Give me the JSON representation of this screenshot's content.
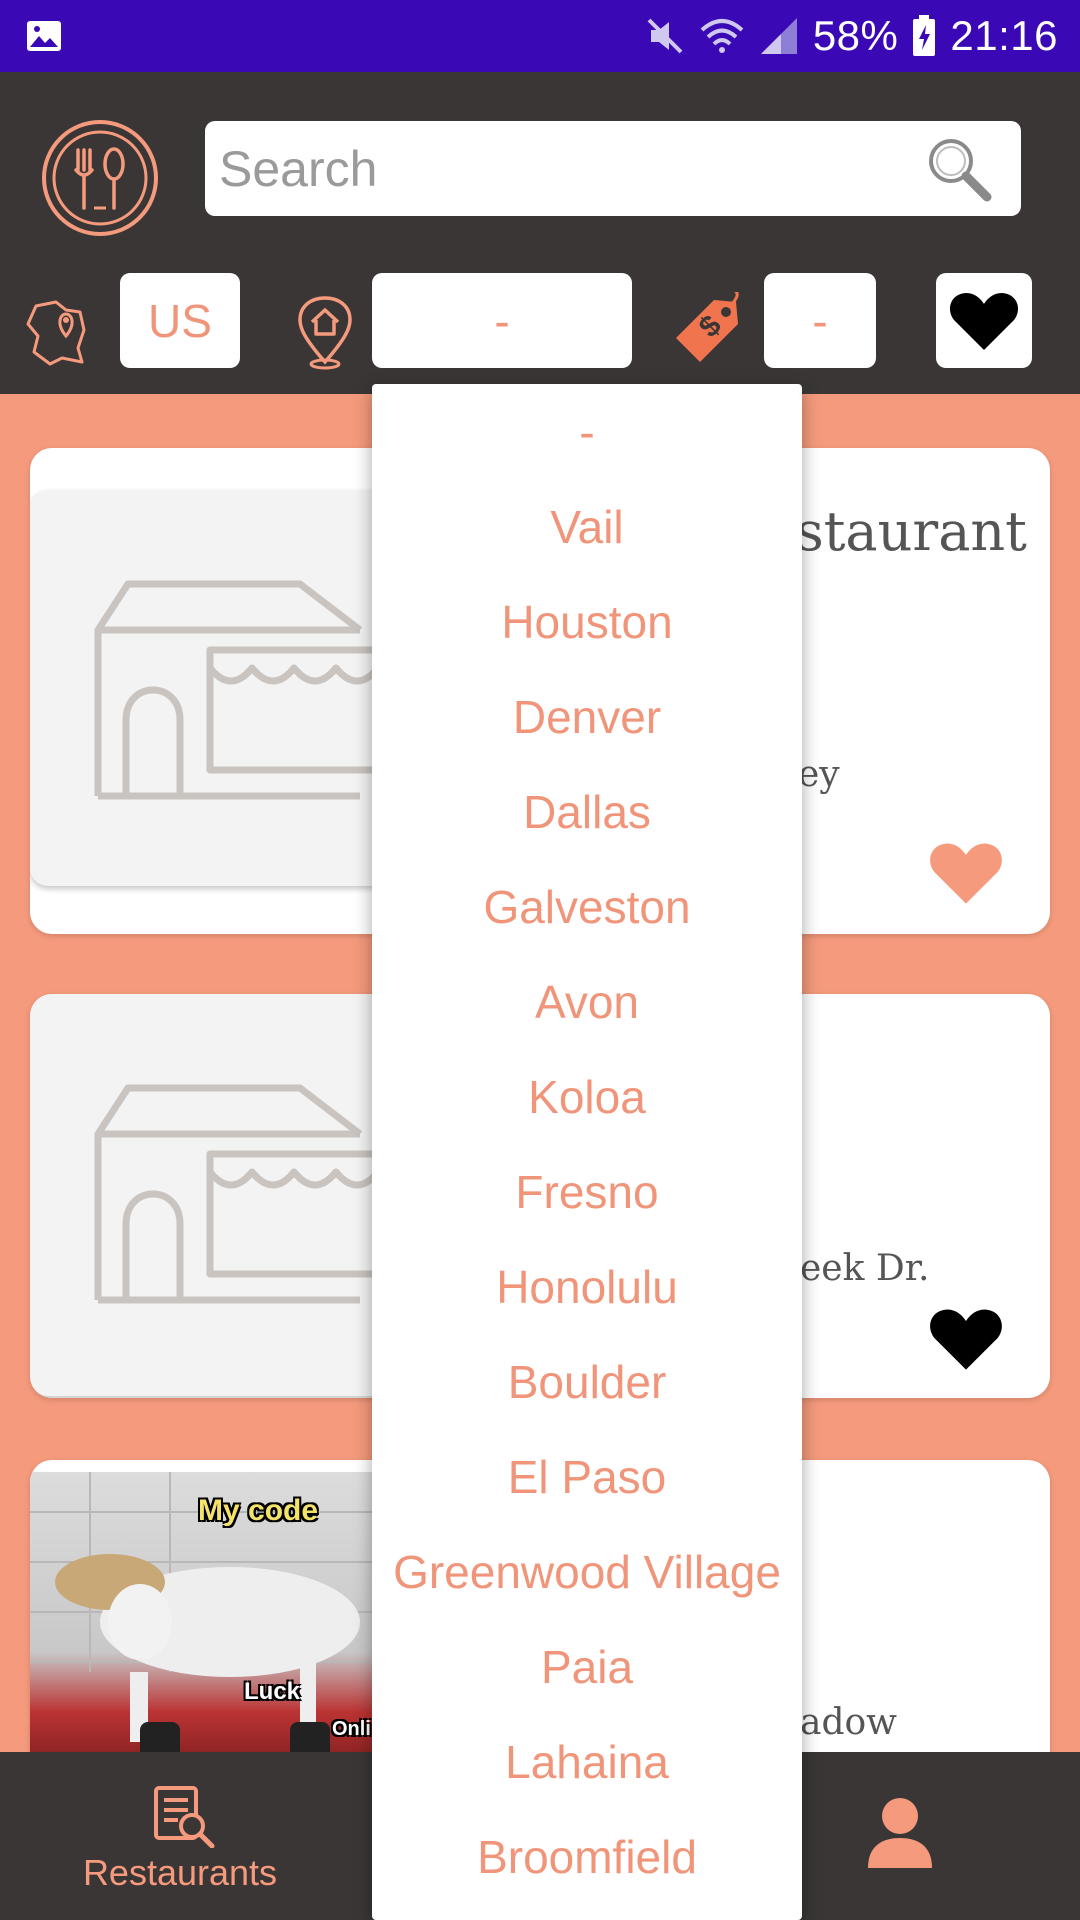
{
  "status_bar": {
    "battery": "58%",
    "time": "21:16"
  },
  "search": {
    "placeholder": "Search"
  },
  "filters": {
    "country": "US",
    "city": "-",
    "price": "-"
  },
  "cards": [
    {
      "title_fragment": "staurant",
      "subtitle_fragment": "ey",
      "favorite": true
    },
    {
      "subtitle_fragment": "eek Dr.",
      "favorite": false
    },
    {
      "subtitle_fragment": "adow",
      "meme_caption_top": "My code",
      "meme_caption_bottom": "Luck",
      "meme_caption_side": "Onli"
    }
  ],
  "dropdown": {
    "options": [
      "-",
      "Vail",
      "Houston",
      "Denver",
      "Dallas",
      "Galveston",
      "Avon",
      "Koloa",
      "Fresno",
      "Honolulu",
      "Boulder",
      "El Paso",
      "Greenwood Village",
      "Paia",
      "Lahaina",
      "Broomfield"
    ]
  },
  "bottom_nav": {
    "restaurants_label": "Restaurants"
  },
  "colors": {
    "accent": "#f59a7c",
    "header_bg": "#3a3636",
    "status_bar": "#3a08b4"
  },
  "icons": [
    "image-icon",
    "mute-icon",
    "wifi-icon",
    "signal-icon",
    "battery-icon",
    "logo-icon",
    "search-icon",
    "map-icon",
    "location-icon",
    "price-tag-icon",
    "heart-icon",
    "store-icon",
    "restaurant-list-icon",
    "user-icon"
  ]
}
